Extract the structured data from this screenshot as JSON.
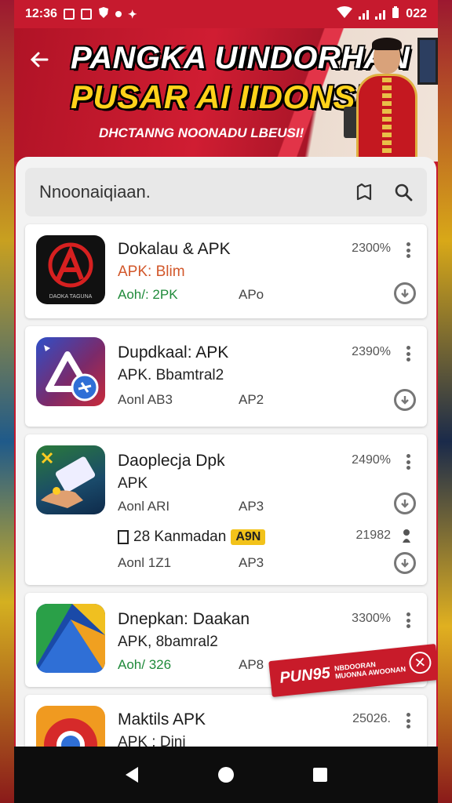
{
  "status_bar": {
    "time": "12:36",
    "right_text": "022"
  },
  "banner": {
    "title_line1": "PANGKA UINDORHAN",
    "title_line2": "PUSAR AI IIDONSIA!",
    "subtitle": "DHCTANNG NOONADU LBEUSI!"
  },
  "search": {
    "placeholder": "Nnoonaiqiaan."
  },
  "apps": [
    {
      "name": "Dokalau & APK",
      "line2": "APK: Blim",
      "line3": "Aoh/: 2PK",
      "line3b": "APo",
      "size": "2300%"
    },
    {
      "name": "Dupdkaal: APK",
      "line2": "APK. Bbamtral2",
      "line3": "Aonl AB3",
      "line3b": "AP2",
      "size": "2390%"
    },
    {
      "name": "Daoplecja Dpk",
      "line2": "APK",
      "line3": "Aonl ARI",
      "line3b": "AP3",
      "size": "2490%",
      "sub_name": "28 Kanmadan",
      "sub_badge": "A9N",
      "sub_size": "21982",
      "sub_line3": "Aonl 1Z1",
      "sub_line3b": "AP3"
    },
    {
      "name": "Dnepkan: Daakan",
      "line2": "APK, 8bamral2",
      "line3": "Aoh/ 326",
      "line3b": "AP8",
      "size": "3300%"
    },
    {
      "name": "Maktils APK",
      "line2": "APK : Dini",
      "size": "25026."
    }
  ],
  "promo": {
    "big": "PUN95",
    "small_line1": "NBDOORAN",
    "small_line2": "MUONNA AWOONAN"
  },
  "icon_logo_text": "DAOKA TAGUNA",
  "colors": {
    "banner_red": "#c61a2e",
    "title_yellow": "#ffd21a",
    "accent_orange": "#d2572a",
    "accent_green": "#1f8a3a",
    "badge_yellow": "#f2c21a"
  }
}
